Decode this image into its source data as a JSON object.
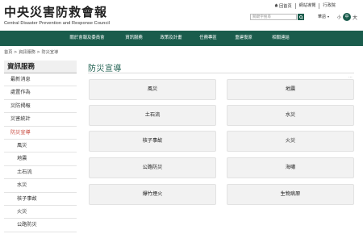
{
  "header": {
    "logo_title": "中央災害防救會報",
    "logo_subtitle": "Central Disaster Prevention and Response Council",
    "util_links": [
      "回首頁",
      "網站導覽",
      "行政院"
    ],
    "search_placeholder": "關鍵字搜尋",
    "lang_label": "華語",
    "font_small": "小",
    "font_mid": "中",
    "font_large": "大"
  },
  "nav": {
    "items": [
      "關於會報及委員會",
      "資訊服務",
      "政策及計畫",
      "任務專區",
      "重建復原",
      "相關連結"
    ]
  },
  "breadcrumb": {
    "home": "首頁",
    "sep1": ">",
    "level1": "資訊服務",
    "sep2": ">",
    "level2": "防災宣導"
  },
  "sidebar": {
    "heading": "資訊服務",
    "items": [
      "最新消息",
      "處置作為",
      "災防揭報",
      "災害統計",
      "防災宣導"
    ],
    "subitems": [
      "風災",
      "地震",
      "土石流",
      "水災",
      "核子事故",
      "火災",
      "公路防災"
    ]
  },
  "main": {
    "title": "防災宣導",
    "more": "...",
    "tiles": [
      "風災",
      "地震",
      "土石流",
      "水災",
      "核子事故",
      "火災",
      "公路防災",
      "海嘯",
      "爆竹煙火",
      "生物病原"
    ]
  },
  "colors": {
    "brand_green": "#1a5c4c",
    "active_red": "#c7463a",
    "tile_bg": "#f2f2f2"
  }
}
